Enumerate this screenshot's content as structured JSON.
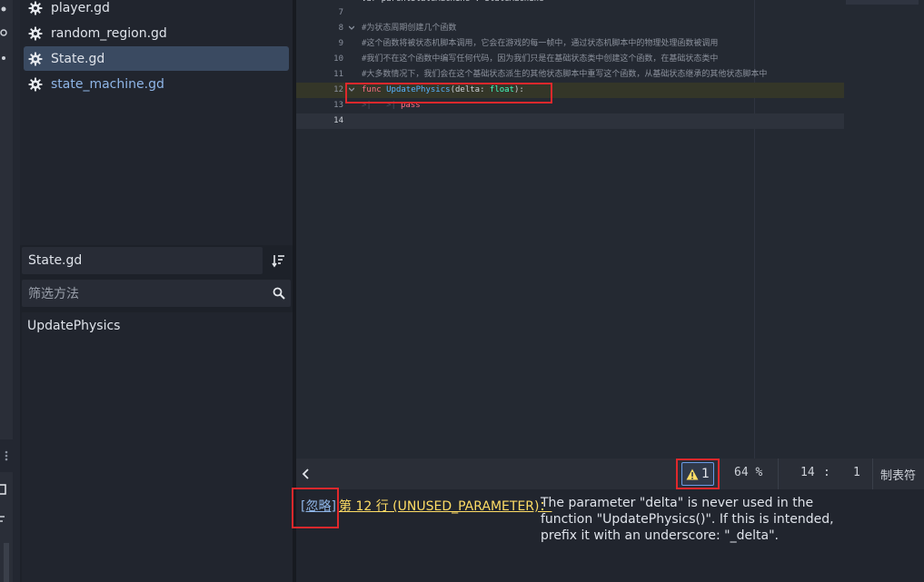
{
  "sidebar": {
    "scripts": [
      {
        "label": "player.gd",
        "selected": false
      },
      {
        "label": "random_region.gd",
        "selected": false
      },
      {
        "label": "State.gd",
        "selected": true
      },
      {
        "label": "state_machine.gd",
        "selected": false
      }
    ],
    "current_script": "State.gd",
    "filter_placeholder": "筛选方法",
    "methods": [
      "UpdatePhysics"
    ]
  },
  "editor": {
    "lines": [
      {
        "num": "7",
        "text": ""
      },
      {
        "num": "8",
        "text": "#为状态周期创建几个函数"
      },
      {
        "num": "9",
        "text": "#这个函数将被状态机脚本调用，它会在游戏的每一帧中，通过状态机脚本中的物理处理函数被调用"
      },
      {
        "num": "10",
        "text": "#我们不在这个函数中编写任何代码，因为我们只是在基础状态类中创建这个函数，在基础状态类中"
      },
      {
        "num": "11",
        "text": "#大多数情况下，我们会在这个基础状态派生的其他状态脚本中重写这个函数，从基础状态继承的其他状态脚本中"
      },
      {
        "num": "12",
        "keyword": "func",
        "name": "UpdatePhysics",
        "param": "delta",
        "type": "float"
      },
      {
        "num": "13",
        "keyword": "pass"
      },
      {
        "num": "14",
        "text": ""
      }
    ],
    "top_partial_text": "var parentStateMachine : StateMachine"
  },
  "statusbar": {
    "back_icon": "chevron-left-icon",
    "warning_icon": "warning-icon",
    "warning_count": "1",
    "zoom": "64 %",
    "cursor_line": "14",
    "cursor_sep": ":",
    "cursor_col": "1",
    "indent_mode": "制表符"
  },
  "output": {
    "ignore_link": "[忽略]",
    "location": "第 12 行 (UNUSED_PARAMETER)：",
    "message": "The parameter \"delta\" is never used in the function \"UpdatePhysics()\". If this is intended, prefix it with an underscore: \"_delta\"."
  },
  "colors": {
    "accent": "#699ce8",
    "highlight_box": "#e0282c",
    "warning": "#ffdd65",
    "keyword": "#ff7085",
    "function": "#57b3ff",
    "type": "#42ffc2"
  }
}
